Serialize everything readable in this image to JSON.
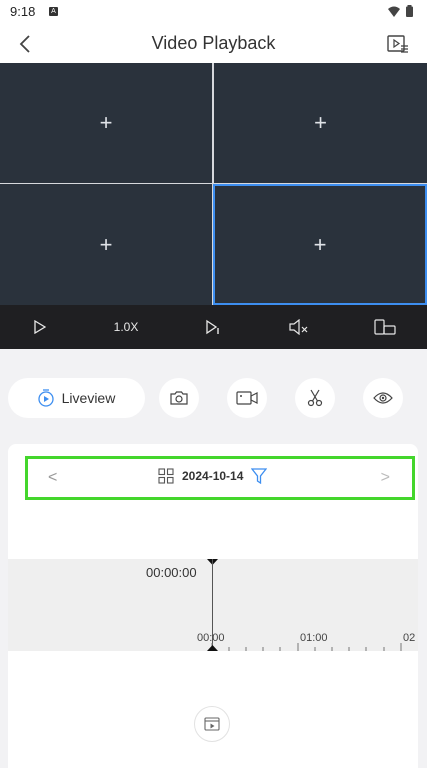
{
  "status_bar": {
    "time": "9:18",
    "notification_icon": "a-square-icon",
    "icons": [
      "wifi-icon",
      "battery-icon"
    ]
  },
  "header": {
    "title": "Video Playback",
    "back_icon": "chevron-left-icon",
    "action_icon": "playlist-icon"
  },
  "video_grid": {
    "cells": [
      {
        "label": "+"
      },
      {
        "label": "+"
      },
      {
        "label": "+"
      },
      {
        "label": "+",
        "selected": true
      }
    ],
    "accent_color": "#3d8ef0"
  },
  "playback_controls": {
    "speed": "1.0X",
    "icons": [
      "play-icon",
      "step-forward-icon",
      "mute-icon",
      "rotate-screen-icon"
    ]
  },
  "actions": {
    "liveview_label": "Liveview",
    "buttons": [
      "camera-icon",
      "video-record-icon",
      "scissors-icon",
      "eye-icon"
    ]
  },
  "date_bar": {
    "date": "2024-10-14",
    "prev": "<",
    "next": ">",
    "highlight_color": "#44d62c"
  },
  "timeline": {
    "current_time": "00:00:00",
    "tick_labels": [
      "00:00",
      "01:00",
      "02"
    ]
  }
}
